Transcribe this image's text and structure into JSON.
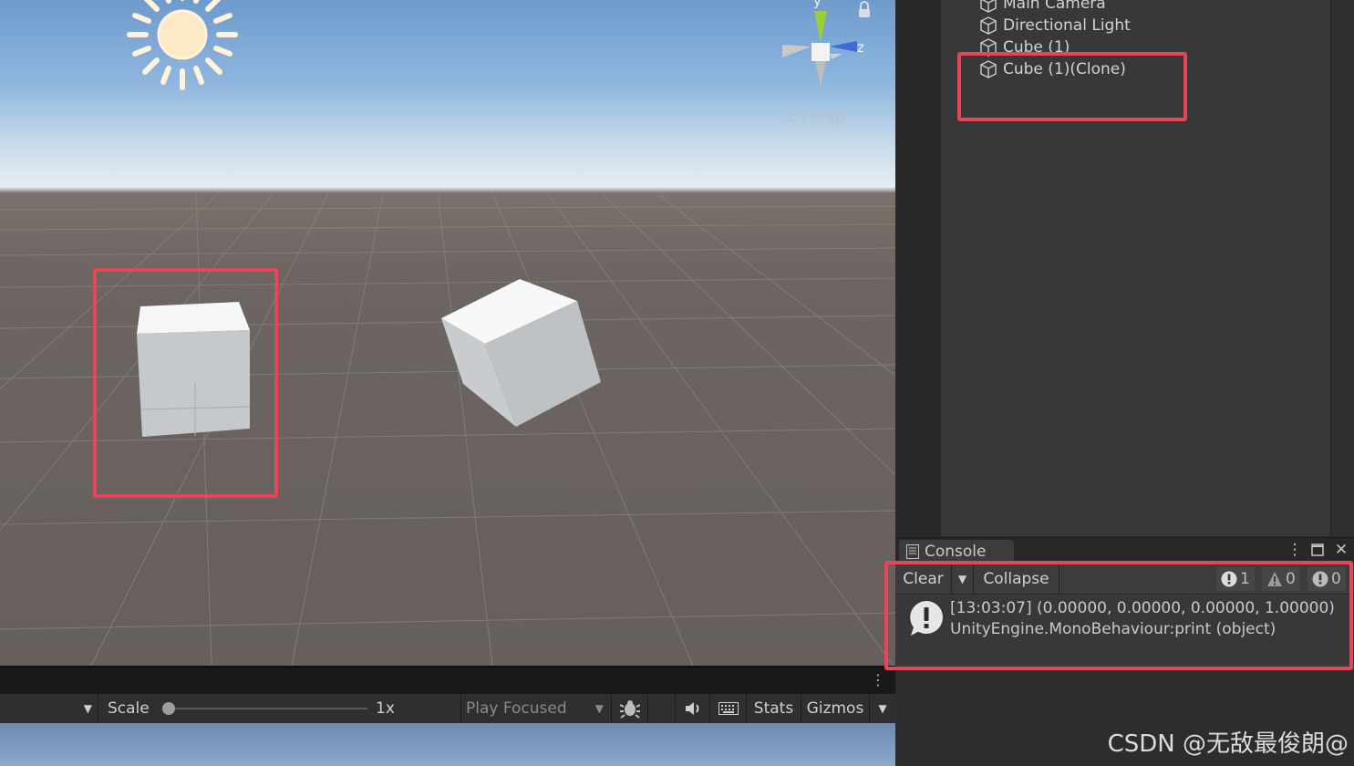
{
  "scene": {
    "view_mode_label": "Persp",
    "gizmo_axes": {
      "y": "y",
      "z": "z"
    },
    "icons": [
      "sun-icon",
      "lock-icon",
      "scene-gizmo-icon"
    ]
  },
  "hierarchy": {
    "items": [
      {
        "label": "Main Camera",
        "icon": "cube-icon"
      },
      {
        "label": "Directional Light",
        "icon": "cube-icon"
      },
      {
        "label": "Cube (1)",
        "icon": "cube-icon"
      },
      {
        "label": "Cube (1)(Clone)",
        "icon": "cube-icon"
      }
    ]
  },
  "console": {
    "tab_label": "Console",
    "toolbar": {
      "clear_label": "Clear",
      "collapse_label": "Collapse",
      "info_count": "1",
      "warning_count": "0",
      "error_count": "0"
    },
    "entry": {
      "line1": "[13:03:07] (0.00000, 0.00000, 0.00000, 1.00000)",
      "line2": "UnityEngine.MonoBehaviour:print (object)"
    }
  },
  "gamebar": {
    "scale_label": "Scale",
    "scale_value": "1x",
    "scale_fraction": 0.0,
    "play_mode": "Play Focused",
    "stats_label": "Stats",
    "gizmos_label": "Gizmos"
  },
  "watermark": "CSDN @无敌最俊朗@",
  "colors": {
    "highlight": "#e9455a",
    "panel": "#383838",
    "text": "#d2d2d2"
  }
}
